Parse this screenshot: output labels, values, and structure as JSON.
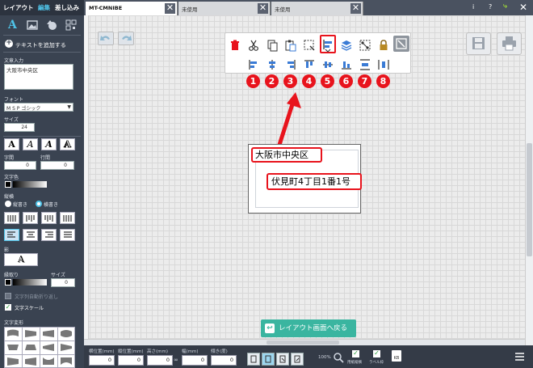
{
  "sidebar": {
    "tabs": [
      "レイアウト",
      "編集",
      "差し込み"
    ],
    "add_text": "テキストを追加する",
    "text_input_label": "文章入力",
    "text_value": "大阪市中央区",
    "font_label": "フォント",
    "font_value": "M S P ゴシック",
    "size_label": "サイズ",
    "size_value": "24",
    "char_spacing_label": "字間",
    "char_spacing_value": "0",
    "line_spacing_label": "行間",
    "line_spacing_value": "0",
    "text_color_label": "文字色",
    "direction_label": "縦横",
    "vertical_label": "縦書き",
    "horizontal_label": "横書き",
    "shadow_label": "影",
    "border_label": "縁取り",
    "border_size_label": "サイズ",
    "border_size_value": "0",
    "wrap_label": "文字列自動折り返し",
    "scale_label": "文字スケール",
    "deform_label": "文字変形"
  },
  "tabs": [
    {
      "label": "MT-CMNIBE",
      "active": true
    },
    {
      "label": "未使用",
      "active": false
    },
    {
      "label": "未使用",
      "active": false
    }
  ],
  "topright": {
    "info": "i",
    "help": "?",
    "exit": "⤷"
  },
  "numbers": [
    "1",
    "2",
    "3",
    "4",
    "5",
    "6",
    "7",
    "8"
  ],
  "label_canvas": {
    "line1": "大阪市中央区",
    "line2": "伏見町4丁目1番1号"
  },
  "back_button": "レイアウト画面へ戻る",
  "bottom": {
    "fields": [
      {
        "label": "横位置(mm)",
        "value": "0"
      },
      {
        "label": "縦位置(mm)",
        "value": "0"
      },
      {
        "label": "高さ(mm)",
        "value": "0"
      },
      {
        "label": "幅(mm)",
        "value": "0"
      },
      {
        "label": "傾き(度)",
        "value": "0"
      }
    ],
    "zoom": "100%",
    "check1": "用紙縦横",
    "check2": "ラベル枠",
    "unit": "KB"
  },
  "colors": {
    "accent": "#4fc3e8",
    "highlight": "#e8131c",
    "sidebar": "#3a4351",
    "back_button": "#3ab5a0"
  }
}
